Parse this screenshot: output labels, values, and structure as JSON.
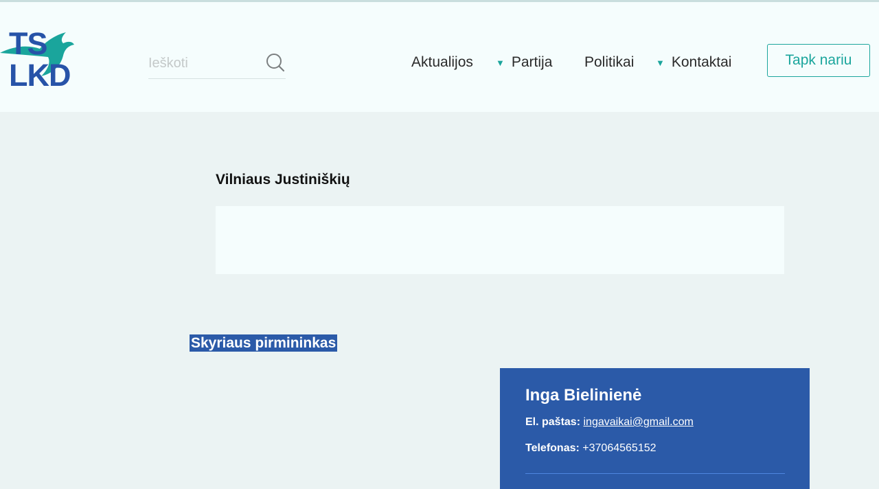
{
  "logo": {
    "line1": "TS",
    "line2": "LKD"
  },
  "search": {
    "placeholder": "Ieškoti"
  },
  "nav": {
    "items": [
      {
        "label": "Aktualijos",
        "has_dropdown": false
      },
      {
        "label": "Partija",
        "has_dropdown": true
      },
      {
        "label": "Politikai",
        "has_dropdown": false
      },
      {
        "label": "Kontaktai",
        "has_dropdown": true
      }
    ],
    "cta_label": "Tapk nariu"
  },
  "main": {
    "branch_title": "Vilniaus Justiniškių",
    "section_heading": "Skyriaus pirmininkas",
    "contact": {
      "name": "Inga Bielinienė",
      "email_label": "El. paštas:",
      "email": "ingavaikai@gmail.com",
      "phone_label": "Telefonas:",
      "phone": "+37064565152"
    }
  },
  "colors": {
    "accent": "#1aa59c",
    "brand_blue": "#2b5aa8",
    "page_bg": "#ebf3f3",
    "header_bg": "#f5fdfd"
  }
}
